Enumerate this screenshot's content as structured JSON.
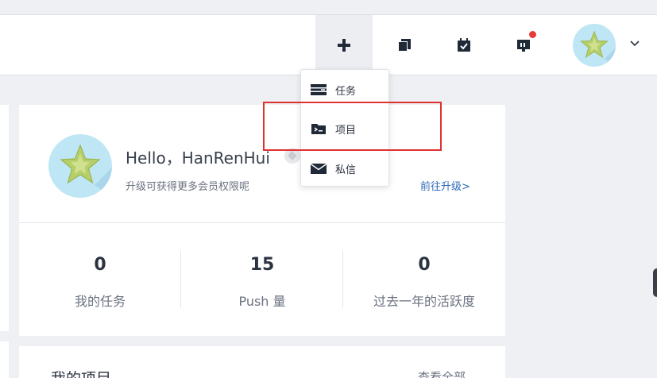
{
  "header": {
    "buttons": [
      {
        "name": "create-button",
        "icon": "plus-icon"
      },
      {
        "name": "documents-button",
        "icon": "documents-icon"
      },
      {
        "name": "calendar-button",
        "icon": "calendar-check-icon"
      },
      {
        "name": "board-button",
        "icon": "board-icon",
        "has_notification": true
      }
    ],
    "notification_color": "#e83a3a"
  },
  "create_menu": {
    "items": [
      {
        "label": "任务",
        "icon": "task-icon"
      },
      {
        "label": "项目",
        "icon": "project-folder-icon"
      },
      {
        "label": "私信",
        "icon": "mail-icon"
      }
    ],
    "highlight_color": "#e03131"
  },
  "profile": {
    "greeting": "Hello，HanRenHui",
    "upgrade_tip": "升级可获得更多会员权限呢",
    "upgrade_link": "前往升级>",
    "link_color": "#2e6ab8"
  },
  "stats": [
    {
      "value": "0",
      "label": "我的任务"
    },
    {
      "value": "15",
      "label": "Push 量"
    },
    {
      "value": "0",
      "label": "过去一年的活跃度"
    }
  ],
  "projects": {
    "title": "我的项目",
    "view_all": "查看全部"
  }
}
